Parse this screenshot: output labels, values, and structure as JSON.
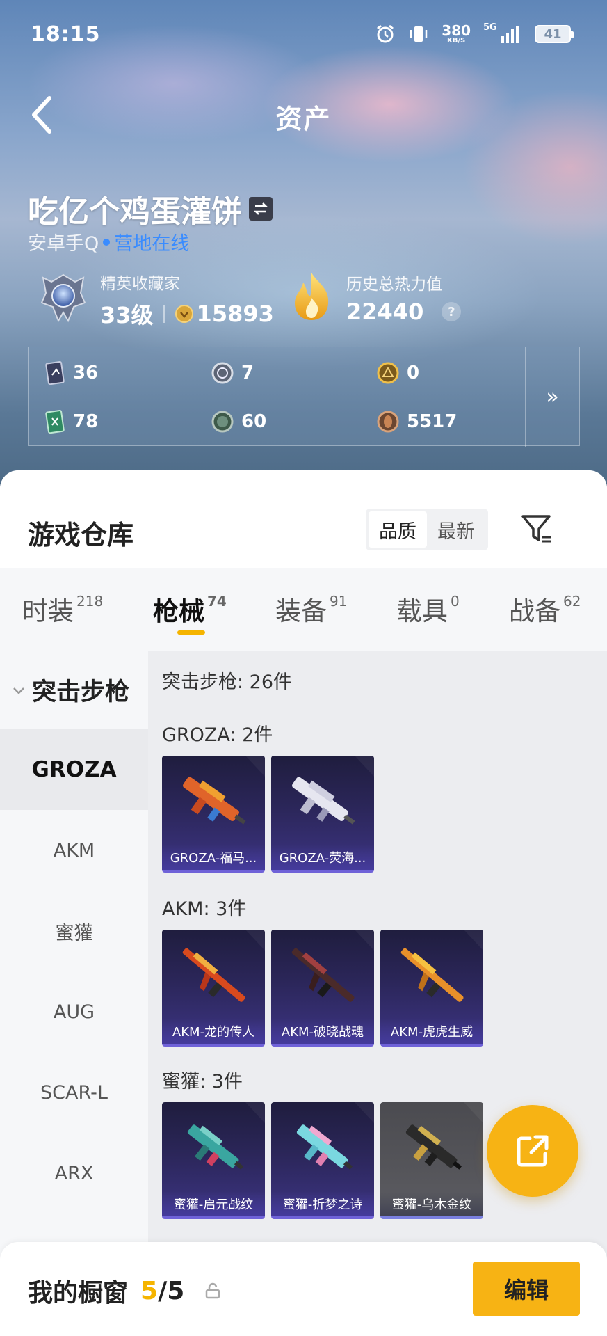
{
  "status_bar": {
    "time": "18:15",
    "net_speed": "380",
    "net_unit": "KB/S",
    "signal_label": "5G",
    "battery": "41",
    "icons": [
      "alarm-icon",
      "vibrate-icon",
      "net-speed-icon",
      "signal-icon",
      "battery-icon"
    ]
  },
  "header": {
    "title": "资产",
    "back_icon": "chevron-left-icon"
  },
  "profile": {
    "name": "吃亿个鸡蛋灌饼",
    "platform": "安卓手Q",
    "online_status": "营地在线",
    "collector": {
      "label": "精英收藏家",
      "level": "33级",
      "coins": "15893"
    },
    "heat": {
      "label": "历史总热力值",
      "value": "22440",
      "help": "?"
    }
  },
  "counts": [
    {
      "icon": "card-dark-icon",
      "value": "36"
    },
    {
      "icon": "medal-silver-icon",
      "value": "7"
    },
    {
      "icon": "medal-gold-icon",
      "value": "0"
    },
    {
      "icon": "card-green-icon",
      "value": "78"
    },
    {
      "icon": "token-green-icon",
      "value": "60"
    },
    {
      "icon": "token-bronze-icon",
      "value": "5517"
    }
  ],
  "counts_more": "»",
  "warehouse": {
    "title": "游戏仓库",
    "sort_options": [
      "品质",
      "最新"
    ],
    "sort_selected": "品质"
  },
  "tabs": [
    {
      "label": "时装",
      "count": "218"
    },
    {
      "label": "枪械",
      "count": "74"
    },
    {
      "label": "装备",
      "count": "91"
    },
    {
      "label": "载具",
      "count": "0"
    },
    {
      "label": "战备",
      "count": "62"
    }
  ],
  "active_tab": "枪械",
  "side_nav": {
    "header": "突击步枪",
    "items": [
      "GROZA",
      "AKM",
      "蜜獾",
      "AUG",
      "SCAR-L",
      "ARX"
    ],
    "active": "GROZA"
  },
  "content": {
    "category_summary": "突击步枪: 26件",
    "groups": [
      {
        "label": "GROZA: 2件",
        "items": [
          "GROZA-福马...",
          "GROZA-荧海..."
        ]
      },
      {
        "label": "AKM: 3件",
        "items": [
          "AKM-龙的传人",
          "AKM-破晓战魂",
          "AKM-虎虎生威"
        ]
      },
      {
        "label": "蜜獾: 3件",
        "items": [
          "蜜獾-启元战纹",
          "蜜獾-折梦之诗",
          "蜜獾-乌木金纹"
        ]
      }
    ]
  },
  "bottom_bar": {
    "label": "我的橱窗",
    "current": "5",
    "total": "/5",
    "edit_label": "编辑"
  },
  "colors": {
    "accent": "#f7b314",
    "online_blue": "#3a8cff",
    "card_bottom": "#6f62d8"
  }
}
